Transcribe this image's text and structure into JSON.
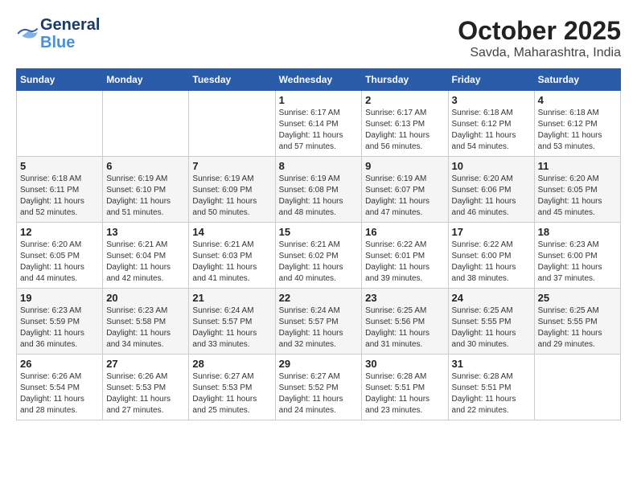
{
  "header": {
    "logo": {
      "line1": "General",
      "line2": "Blue",
      "icon": "🔷"
    },
    "title": "October 2025",
    "subtitle": "Savda, Maharashtra, India"
  },
  "weekdays": [
    "Sunday",
    "Monday",
    "Tuesday",
    "Wednesday",
    "Thursday",
    "Friday",
    "Saturday"
  ],
  "weeks": [
    [
      {
        "day": "",
        "info": ""
      },
      {
        "day": "",
        "info": ""
      },
      {
        "day": "",
        "info": ""
      },
      {
        "day": "1",
        "info": "Sunrise: 6:17 AM\nSunset: 6:14 PM\nDaylight: 11 hours\nand 57 minutes."
      },
      {
        "day": "2",
        "info": "Sunrise: 6:17 AM\nSunset: 6:13 PM\nDaylight: 11 hours\nand 56 minutes."
      },
      {
        "day": "3",
        "info": "Sunrise: 6:18 AM\nSunset: 6:12 PM\nDaylight: 11 hours\nand 54 minutes."
      },
      {
        "day": "4",
        "info": "Sunrise: 6:18 AM\nSunset: 6:12 PM\nDaylight: 11 hours\nand 53 minutes."
      }
    ],
    [
      {
        "day": "5",
        "info": "Sunrise: 6:18 AM\nSunset: 6:11 PM\nDaylight: 11 hours\nand 52 minutes."
      },
      {
        "day": "6",
        "info": "Sunrise: 6:19 AM\nSunset: 6:10 PM\nDaylight: 11 hours\nand 51 minutes."
      },
      {
        "day": "7",
        "info": "Sunrise: 6:19 AM\nSunset: 6:09 PM\nDaylight: 11 hours\nand 50 minutes."
      },
      {
        "day": "8",
        "info": "Sunrise: 6:19 AM\nSunset: 6:08 PM\nDaylight: 11 hours\nand 48 minutes."
      },
      {
        "day": "9",
        "info": "Sunrise: 6:19 AM\nSunset: 6:07 PM\nDaylight: 11 hours\nand 47 minutes."
      },
      {
        "day": "10",
        "info": "Sunrise: 6:20 AM\nSunset: 6:06 PM\nDaylight: 11 hours\nand 46 minutes."
      },
      {
        "day": "11",
        "info": "Sunrise: 6:20 AM\nSunset: 6:05 PM\nDaylight: 11 hours\nand 45 minutes."
      }
    ],
    [
      {
        "day": "12",
        "info": "Sunrise: 6:20 AM\nSunset: 6:05 PM\nDaylight: 11 hours\nand 44 minutes."
      },
      {
        "day": "13",
        "info": "Sunrise: 6:21 AM\nSunset: 6:04 PM\nDaylight: 11 hours\nand 42 minutes."
      },
      {
        "day": "14",
        "info": "Sunrise: 6:21 AM\nSunset: 6:03 PM\nDaylight: 11 hours\nand 41 minutes."
      },
      {
        "day": "15",
        "info": "Sunrise: 6:21 AM\nSunset: 6:02 PM\nDaylight: 11 hours\nand 40 minutes."
      },
      {
        "day": "16",
        "info": "Sunrise: 6:22 AM\nSunset: 6:01 PM\nDaylight: 11 hours\nand 39 minutes."
      },
      {
        "day": "17",
        "info": "Sunrise: 6:22 AM\nSunset: 6:00 PM\nDaylight: 11 hours\nand 38 minutes."
      },
      {
        "day": "18",
        "info": "Sunrise: 6:23 AM\nSunset: 6:00 PM\nDaylight: 11 hours\nand 37 minutes."
      }
    ],
    [
      {
        "day": "19",
        "info": "Sunrise: 6:23 AM\nSunset: 5:59 PM\nDaylight: 11 hours\nand 36 minutes."
      },
      {
        "day": "20",
        "info": "Sunrise: 6:23 AM\nSunset: 5:58 PM\nDaylight: 11 hours\nand 34 minutes."
      },
      {
        "day": "21",
        "info": "Sunrise: 6:24 AM\nSunset: 5:57 PM\nDaylight: 11 hours\nand 33 minutes."
      },
      {
        "day": "22",
        "info": "Sunrise: 6:24 AM\nSunset: 5:57 PM\nDaylight: 11 hours\nand 32 minutes."
      },
      {
        "day": "23",
        "info": "Sunrise: 6:25 AM\nSunset: 5:56 PM\nDaylight: 11 hours\nand 31 minutes."
      },
      {
        "day": "24",
        "info": "Sunrise: 6:25 AM\nSunset: 5:55 PM\nDaylight: 11 hours\nand 30 minutes."
      },
      {
        "day": "25",
        "info": "Sunrise: 6:25 AM\nSunset: 5:55 PM\nDaylight: 11 hours\nand 29 minutes."
      }
    ],
    [
      {
        "day": "26",
        "info": "Sunrise: 6:26 AM\nSunset: 5:54 PM\nDaylight: 11 hours\nand 28 minutes."
      },
      {
        "day": "27",
        "info": "Sunrise: 6:26 AM\nSunset: 5:53 PM\nDaylight: 11 hours\nand 27 minutes."
      },
      {
        "day": "28",
        "info": "Sunrise: 6:27 AM\nSunset: 5:53 PM\nDaylight: 11 hours\nand 25 minutes."
      },
      {
        "day": "29",
        "info": "Sunrise: 6:27 AM\nSunset: 5:52 PM\nDaylight: 11 hours\nand 24 minutes."
      },
      {
        "day": "30",
        "info": "Sunrise: 6:28 AM\nSunset: 5:51 PM\nDaylight: 11 hours\nand 23 minutes."
      },
      {
        "day": "31",
        "info": "Sunrise: 6:28 AM\nSunset: 5:51 PM\nDaylight: 11 hours\nand 22 minutes."
      },
      {
        "day": "",
        "info": ""
      }
    ]
  ]
}
